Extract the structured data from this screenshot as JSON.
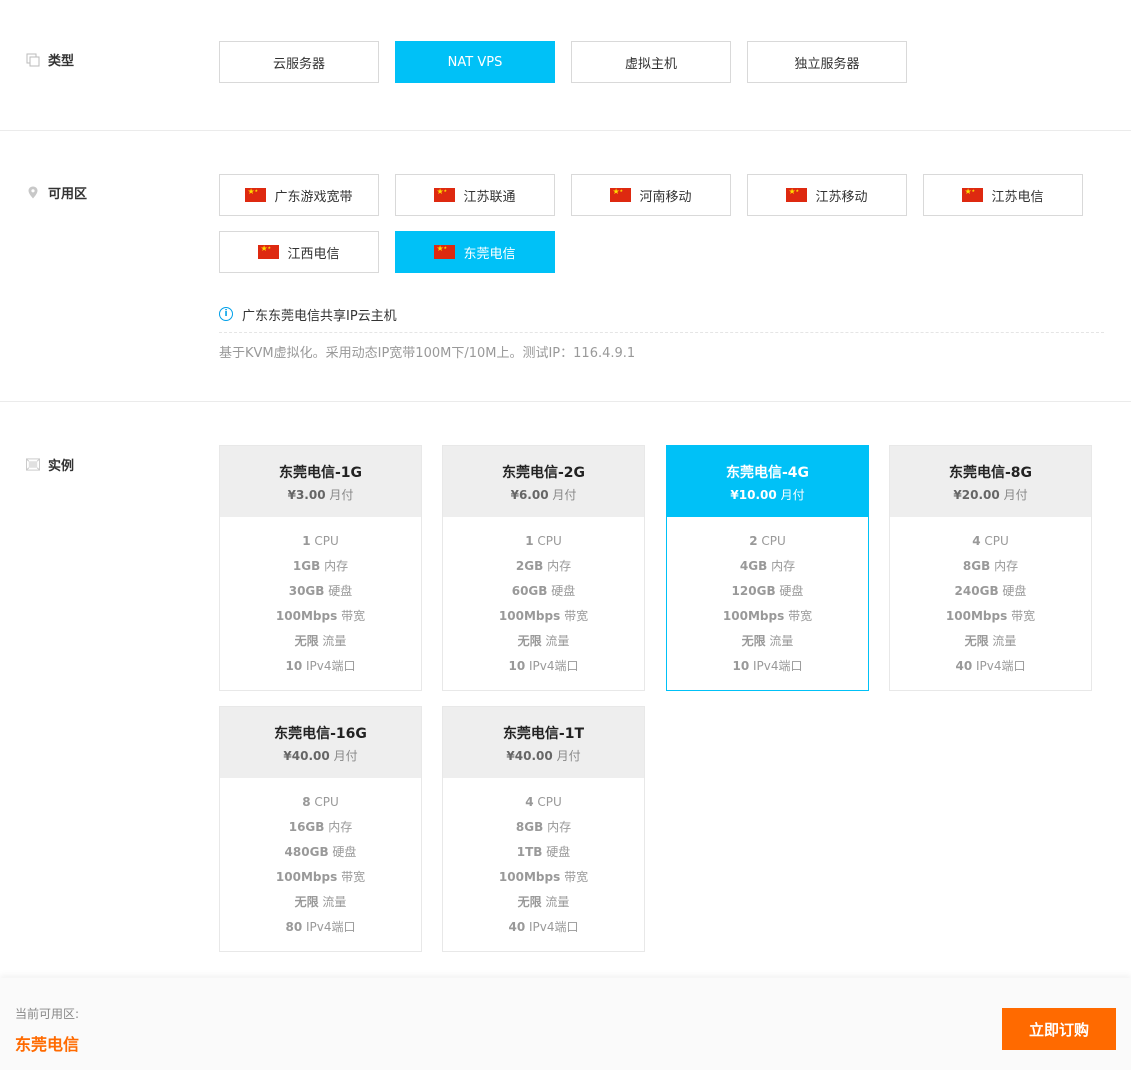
{
  "type_section": {
    "label": "类型",
    "options": [
      "云服务器",
      "NAT VPS",
      "虚拟主机",
      "独立服务器"
    ],
    "selected": "NAT VPS"
  },
  "zone_section": {
    "label": "可用区",
    "options": [
      "广东游戏宽带",
      "江苏联通",
      "河南移动",
      "江苏移动",
      "江苏电信",
      "江西电信",
      "东莞电信"
    ],
    "selected": "东莞电信",
    "info_title": "广东东莞电信共享IP云主机",
    "info_desc": "基于KVM虚拟化。采用动态IP宽带100M下/10M上。测试IP：116.4.9.1"
  },
  "instance_section": {
    "label": "实例",
    "price_unit": "月付",
    "selected": "东莞电信-4G",
    "plans": [
      {
        "name": "东莞电信-1G",
        "price": "¥3.00",
        "cpu": "1",
        "ram": "1GB",
        "disk": "30GB",
        "bw": "100Mbps",
        "traffic": "无限",
        "ports": "10"
      },
      {
        "name": "东莞电信-2G",
        "price": "¥6.00",
        "cpu": "1",
        "ram": "2GB",
        "disk": "60GB",
        "bw": "100Mbps",
        "traffic": "无限",
        "ports": "10"
      },
      {
        "name": "东莞电信-4G",
        "price": "¥10.00",
        "cpu": "2",
        "ram": "4GB",
        "disk": "120GB",
        "bw": "100Mbps",
        "traffic": "无限",
        "ports": "10"
      },
      {
        "name": "东莞电信-8G",
        "price": "¥20.00",
        "cpu": "4",
        "ram": "8GB",
        "disk": "240GB",
        "bw": "100Mbps",
        "traffic": "无限",
        "ports": "40"
      },
      {
        "name": "东莞电信-16G",
        "price": "¥40.00",
        "cpu": "8",
        "ram": "16GB",
        "disk": "480GB",
        "bw": "100Mbps",
        "traffic": "无限",
        "ports": "80"
      },
      {
        "name": "东莞电信-1T",
        "price": "¥40.00",
        "cpu": "4",
        "ram": "8GB",
        "disk": "1TB",
        "bw": "100Mbps",
        "traffic": "无限",
        "ports": "40"
      }
    ],
    "spec_labels": {
      "cpu": "CPU",
      "ram": "内存",
      "disk": "硬盘",
      "bw": "带宽",
      "traffic": "流量",
      "ports": "IPv4端口"
    }
  },
  "footer": {
    "current_zone_label": "当前可用区:",
    "current_zone_value": "东莞电信",
    "buy_label": "立即订购"
  },
  "colors": {
    "accent": "#00c1f7",
    "buy": "#ff6a00"
  }
}
